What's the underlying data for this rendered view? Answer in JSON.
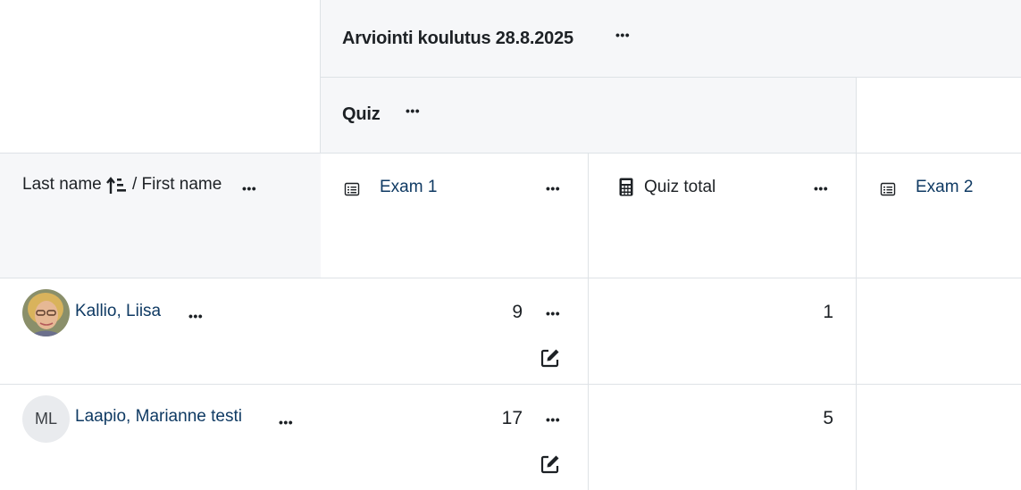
{
  "category": {
    "title": "Arviointi koulutus 28.8.2025",
    "subcategory": "Quiz"
  },
  "columns": {
    "name_header": {
      "last_name": "Last name",
      "separator": "/ First name",
      "sort_icon": "sort-ascending-icon"
    },
    "items": [
      {
        "label": "Exam 1",
        "icon": "quiz-icon"
      },
      {
        "label": "Quiz total",
        "icon": "calculator-icon"
      },
      {
        "label": "Exam 2",
        "icon": "quiz-icon"
      }
    ]
  },
  "rows": [
    {
      "name": "Kallio, Liisa",
      "avatar": "photo",
      "initials": "",
      "exam1": "9",
      "quiz_total": "1"
    },
    {
      "name": "Laapio, Marianne testi",
      "avatar": "initials",
      "initials": "ML",
      "exam1": "17",
      "quiz_total": "5"
    }
  ]
}
